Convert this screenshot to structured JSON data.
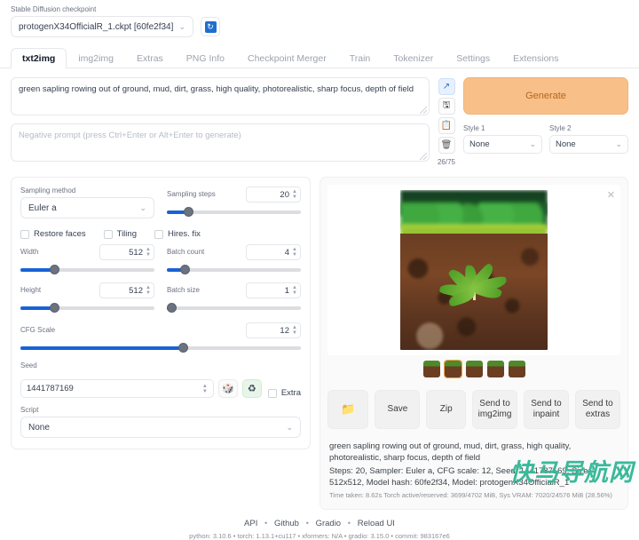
{
  "checkpoint": {
    "label": "Stable Diffusion checkpoint",
    "value": "protogenX34OfficialR_1.ckpt [60fe2f34]",
    "chevron": "⌄",
    "refresh_icon": "↻"
  },
  "tabs": [
    {
      "label": "txt2img",
      "active": true
    },
    {
      "label": "img2img",
      "active": false
    },
    {
      "label": "Extras",
      "active": false
    },
    {
      "label": "PNG Info",
      "active": false
    },
    {
      "label": "Checkpoint Merger",
      "active": false
    },
    {
      "label": "Train",
      "active": false
    },
    {
      "label": "Tokenizer",
      "active": false
    },
    {
      "label": "Settings",
      "active": false
    },
    {
      "label": "Extensions",
      "active": false
    }
  ],
  "prompt": {
    "value": "green sapling rowing out of ground, mud, dirt, grass, high quality, photorealistic, sharp focus, depth of field",
    "negative_placeholder": "Negative prompt (press Ctrl+Enter or Alt+Enter to generate)",
    "token_count": "26/75",
    "tools": [
      {
        "name": "paste-arrow-icon",
        "glyph": "↗"
      },
      {
        "name": "save-style-icon",
        "glyph": "🖫"
      },
      {
        "name": "clipboard-icon",
        "glyph": "📋"
      },
      {
        "name": "trash-icon",
        "glyph": "🗑"
      }
    ]
  },
  "generate": {
    "label": "Generate",
    "accent": "#f8c088"
  },
  "styles": [
    {
      "label": "Style 1",
      "value": "None"
    },
    {
      "label": "Style 2",
      "value": "None"
    }
  ],
  "settings": {
    "sampling_method": {
      "label": "Sampling method",
      "value": "Euler a"
    },
    "sampling_steps": {
      "label": "Sampling steps",
      "value": "20",
      "pct": 16
    },
    "checkboxes": [
      {
        "label": "Restore faces",
        "checked": false
      },
      {
        "label": "Tiling",
        "checked": false
      },
      {
        "label": "Hires. fix",
        "checked": false
      }
    ],
    "width": {
      "label": "Width",
      "value": "512",
      "pct": 25
    },
    "height": {
      "label": "Height",
      "value": "512",
      "pct": 25
    },
    "batch_count": {
      "label": "Batch count",
      "value": "4",
      "pct": 13
    },
    "batch_size": {
      "label": "Batch size",
      "value": "1",
      "pct": 2
    },
    "cfg_scale": {
      "label": "CFG Scale",
      "value": "12",
      "pct": 58
    },
    "seed": {
      "label": "Seed",
      "value": "1441787169"
    },
    "seed_buttons": [
      {
        "name": "recycle-seed-icon",
        "glyph": "🎲"
      },
      {
        "name": "reuse-seed-icon",
        "glyph": "♻"
      }
    ],
    "extra_checkbox": {
      "label": "Extra",
      "checked": false
    },
    "script": {
      "label": "Script",
      "value": "None"
    }
  },
  "gallery": {
    "close_glyph": "✕",
    "thumbs": [
      {
        "selected": false
      },
      {
        "selected": true
      },
      {
        "selected": false
      },
      {
        "selected": false
      },
      {
        "selected": false
      }
    ]
  },
  "output_buttons": [
    {
      "name": "open-folder-button",
      "label": "📁"
    },
    {
      "name": "save-button",
      "label": "Save"
    },
    {
      "name": "zip-button",
      "label": "Zip"
    },
    {
      "name": "send-to-img2img-button",
      "label": "Send to img2img"
    },
    {
      "name": "send-to-inpaint-button",
      "label": "Send to inpaint"
    },
    {
      "name": "send-to-extras-button",
      "label": "Send to extras"
    }
  ],
  "info": {
    "prompt_line": "green sapling rowing out of ground, mud, dirt, grass, high quality, photorealistic, sharp focus, depth of field",
    "params_line": "Steps: 20, Sampler: Euler a, CFG scale: 12, Seed: 1441787169, Size: 512x512, Model hash: 60fe2f34, Model: protogenX34OfficialR_1",
    "timing_line": "Time taken: 8.62s  Torch active/reserved: 3699/4702 MiB, Sys VRAM: 7020/24576 MiB (28.56%)"
  },
  "footer": {
    "links": [
      "API",
      "Github",
      "Gradio",
      "Reload UI"
    ],
    "separator": "•",
    "versions": "python: 3.10.6  •  torch: 1.13.1+cu117  •  xformers: N/A  •  gradio: 3.15.0  •  commit: 983167e6"
  },
  "watermark": {
    "text": "快马导航网",
    "color": "#3ab99a"
  }
}
